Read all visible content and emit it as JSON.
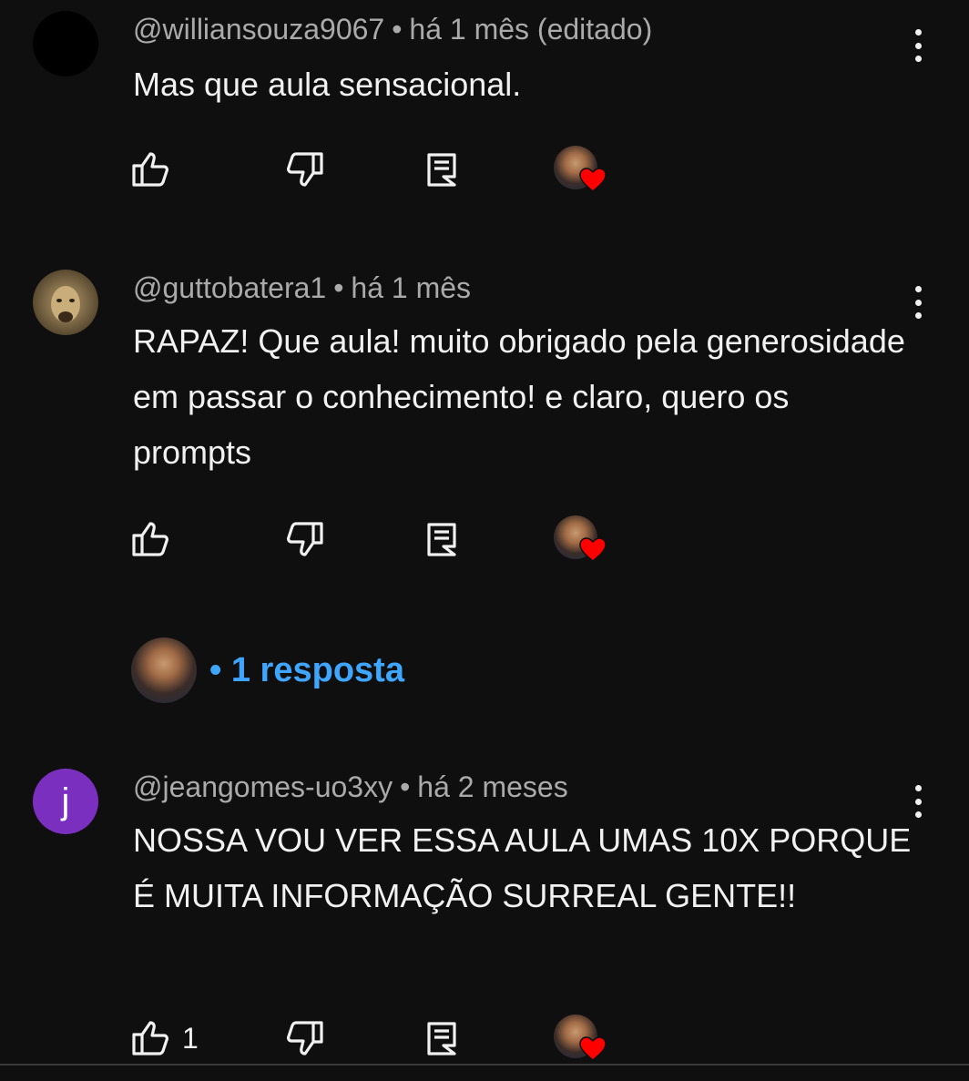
{
  "comments": [
    {
      "handle": "@williansouza9067",
      "separator": "•",
      "time": "há 1 mês (editado)",
      "text": "Mas que aula sensacional.",
      "like_count": ""
    },
    {
      "handle": "@guttobatera1",
      "separator": "•",
      "time": "há 1 mês",
      "text": "RAPAZ! Que aula! muito obrigado pela generosidade em passar  o conhecimento! e claro, quero os prompts",
      "like_count": ""
    },
    {
      "handle": "@jeangomes-uo3xy",
      "separator": "•",
      "time": "há 2 meses",
      "text": "NOSSA VOU VER ESSA AULA UMAS 10X PORQUE É MUITA INFORMAÇÃO SURREAL GENTE!!",
      "like_count": "1",
      "avatar_letter": "j"
    }
  ],
  "replies": {
    "label": "• 1 resposta"
  },
  "colors": {
    "background": "#0f0f0f",
    "text": "#f1f1f1",
    "meta": "#aaaaaa",
    "link": "#3ea6ff",
    "heart": "#ff0000",
    "letter_avatar": "#7b2fbe"
  },
  "icons": [
    "thumbs-up-icon",
    "thumbs-down-icon",
    "reply-icon",
    "creator-heart-icon",
    "more-vert-icon"
  ]
}
